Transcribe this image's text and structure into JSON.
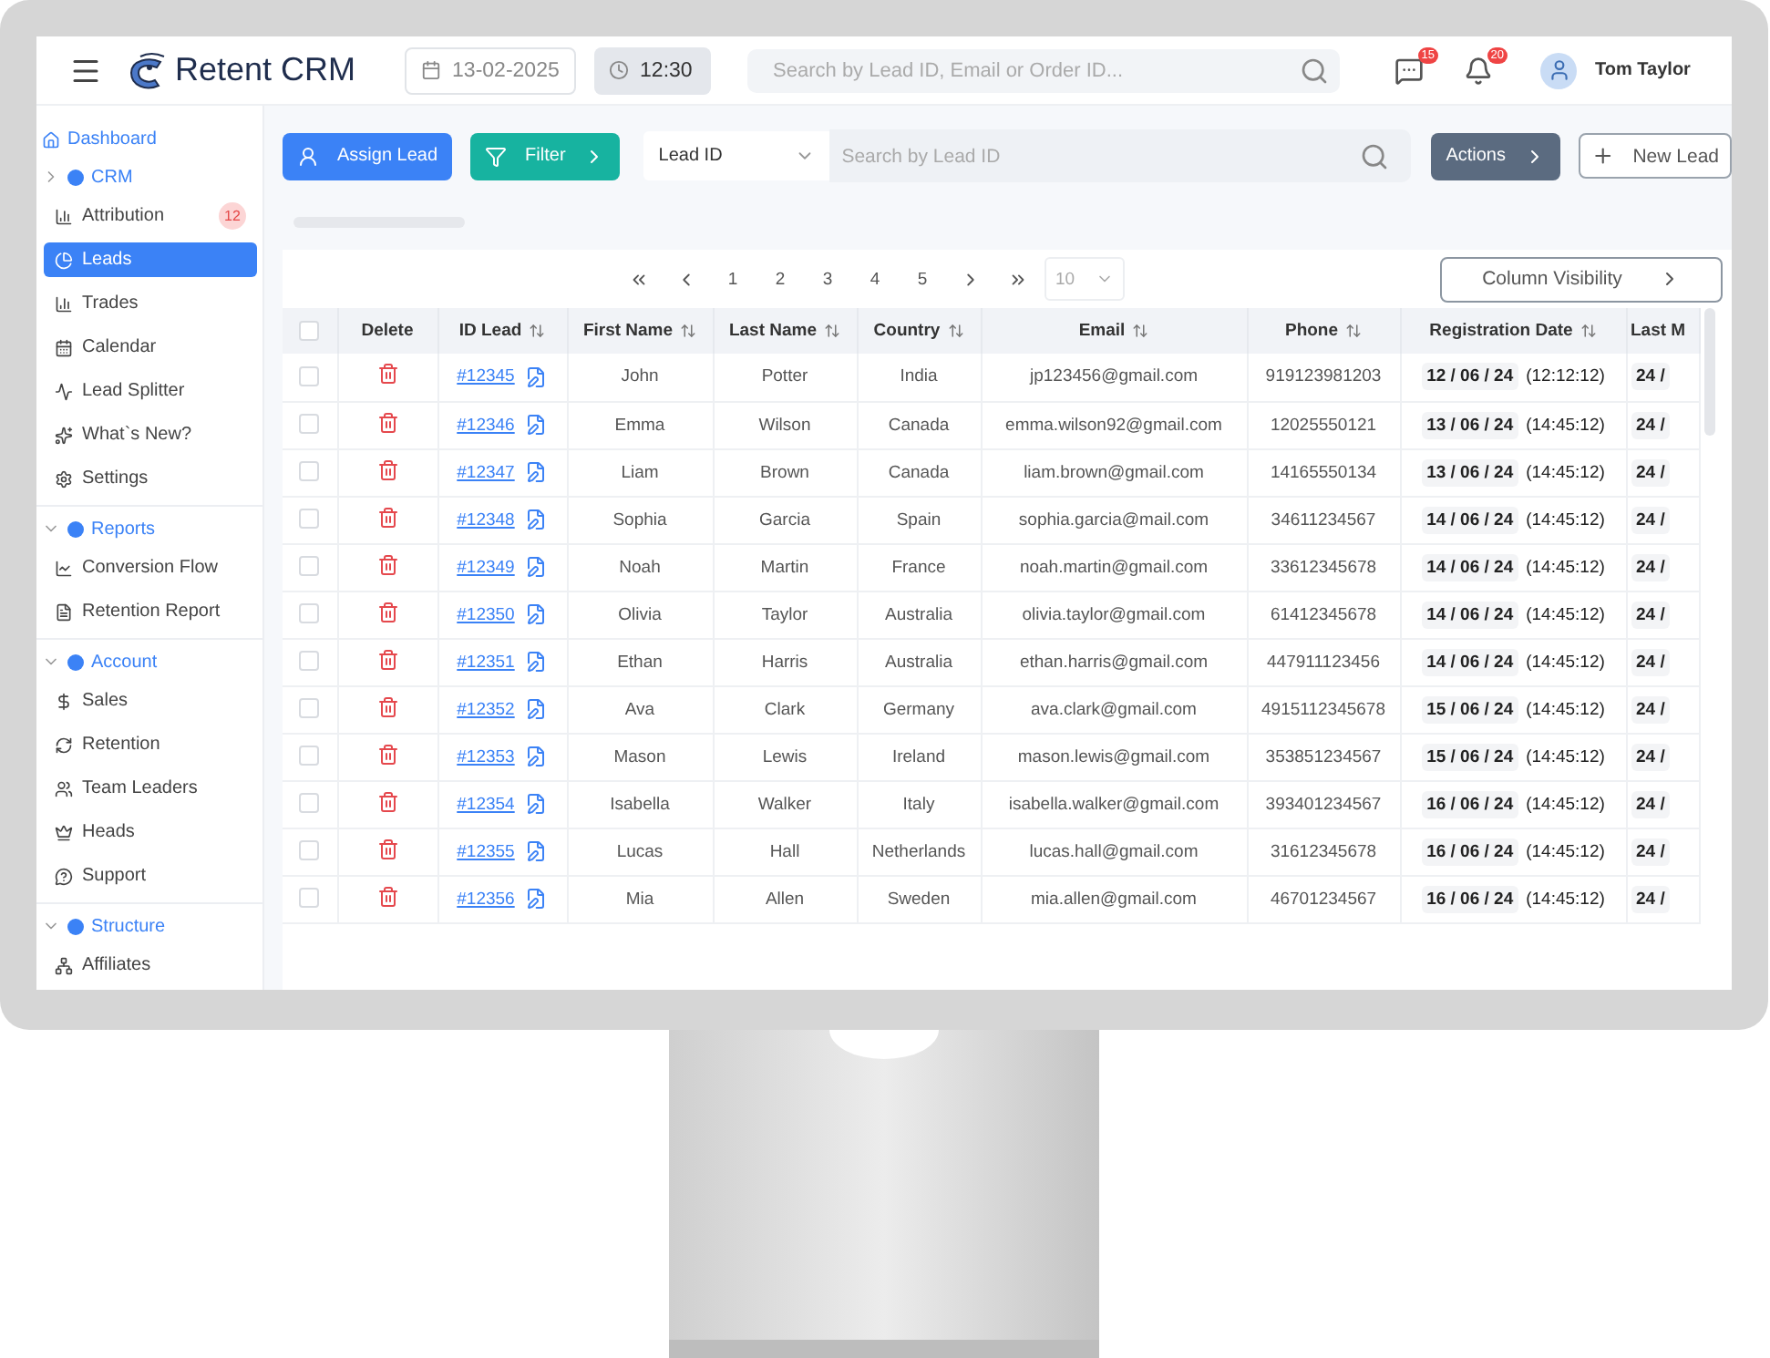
{
  "header": {
    "app_name": "Retent CRM",
    "date": "13-02-2025",
    "time": "12:30",
    "search": {
      "placeholder": "Search by Lead ID, Email or Order ID..."
    },
    "notifications": [
      {
        "count": "15"
      },
      {
        "count": "20"
      }
    ],
    "user": "Tom Taylor"
  },
  "sidebar": {
    "items": [
      {
        "kind": "link",
        "label": "Dashboard"
      },
      {
        "kind": "section",
        "label": "CRM",
        "expanded": false,
        "children": [
          {
            "label": "Attribution",
            "badge": "12",
            "selected": false
          },
          {
            "label": "Leads",
            "selected": true
          },
          {
            "label": "Trades",
            "selected": false
          },
          {
            "label": "Calendar",
            "selected": false
          },
          {
            "label": "Lead Splitter",
            "selected": false
          },
          {
            "label": "What`s New?",
            "selected": false
          },
          {
            "label": "Settings",
            "selected": false
          }
        ]
      },
      {
        "kind": "section",
        "label": "Reports",
        "expanded": true,
        "children": [
          {
            "label": "Conversion Flow",
            "selected": false
          },
          {
            "label": "Retention Report",
            "selected": false
          }
        ]
      },
      {
        "kind": "section",
        "label": "Account",
        "expanded": true,
        "children": [
          {
            "label": "Sales",
            "selected": false
          },
          {
            "label": "Retention",
            "selected": false
          },
          {
            "label": "Team Leaders",
            "selected": false
          },
          {
            "label": "Heads",
            "selected": false
          },
          {
            "label": "Support",
            "selected": false
          }
        ]
      },
      {
        "kind": "section",
        "label": "Structure",
        "expanded": true,
        "children": [
          {
            "label": "Affiliates",
            "selected": false
          }
        ]
      }
    ]
  },
  "toolbar": {
    "assign": "Assign Lead",
    "filter": "Filter",
    "field_select": "Lead ID",
    "search": {
      "placeholder": "Search by Lead ID"
    },
    "actions": "Actions",
    "new_lead": "New Lead"
  },
  "pagination": {
    "pages": [
      "1",
      "2",
      "3",
      "4",
      "5"
    ],
    "page_size": "10"
  },
  "column_visibility": "Column Visibility",
  "table": {
    "columns": [
      {
        "label": "Delete",
        "sortable": false
      },
      {
        "label": "ID Lead",
        "sortable": true
      },
      {
        "label": "First Name",
        "sortable": true
      },
      {
        "label": "Last Name",
        "sortable": true
      },
      {
        "label": "Country",
        "sortable": true
      },
      {
        "label": "Email",
        "sortable": true
      },
      {
        "label": "Phone",
        "sortable": true
      },
      {
        "label": "Registration Date",
        "sortable": true
      },
      {
        "label": "Last M",
        "sortable": false
      }
    ],
    "select_all": {
      "checked": false
    },
    "rows": [
      {
        "checked": false,
        "id": "#12345",
        "first": "John",
        "last": "Potter",
        "country": "India",
        "email": "jp123456@gmail.com",
        "phone": "919123981203",
        "date": "12 / 06 / 24",
        "time": "(12:12:12)",
        "column_9": "24 /"
      },
      {
        "checked": false,
        "id": "#12346",
        "first": "Emma",
        "last": "Wilson",
        "country": "Canada",
        "email": "emma.wilson92@gmail.com",
        "phone": "12025550121",
        "date": "13 / 06 / 24",
        "time": "(14:45:12)",
        "column_9": "24 /"
      },
      {
        "checked": false,
        "id": "#12347",
        "first": "Liam",
        "last": "Brown",
        "country": "Canada",
        "email": "liam.brown@gmail.com",
        "phone": "14165550134",
        "date": "13 / 06 / 24",
        "time": "(14:45:12)",
        "column_9": "24 /"
      },
      {
        "checked": false,
        "id": "#12348",
        "first": "Sophia",
        "last": "Garcia",
        "country": "Spain",
        "email": "sophia.garcia@mail.com",
        "phone": "34611234567",
        "date": "14 / 06 / 24",
        "time": "(14:45:12)",
        "column_9": "24 /"
      },
      {
        "checked": false,
        "id": "#12349",
        "first": "Noah",
        "last": "Martin",
        "country": "France",
        "email": "noah.martin@gmail.com",
        "phone": "33612345678",
        "date": "14 / 06 / 24",
        "time": "(14:45:12)",
        "column_9": "24 /"
      },
      {
        "checked": false,
        "id": "#12350",
        "first": "Olivia",
        "last": "Taylor",
        "country": "Australia",
        "email": "olivia.taylor@gmail.com",
        "phone": "61412345678",
        "date": "14 / 06 / 24",
        "time": "(14:45:12)",
        "column_9": "24 /"
      },
      {
        "checked": false,
        "id": "#12351",
        "first": "Ethan",
        "last": "Harris",
        "country": "Australia",
        "email": "ethan.harris@gmail.com",
        "phone": "447911123456",
        "date": "14 / 06 / 24",
        "time": "(14:45:12)",
        "column_9": "24 /"
      },
      {
        "checked": false,
        "id": "#12352",
        "first": "Ava",
        "last": "Clark",
        "country": "Germany",
        "email": "ava.clark@gmail.com",
        "phone": "4915112345678",
        "date": "15 / 06 / 24",
        "time": "(14:45:12)",
        "column_9": "24 /"
      },
      {
        "checked": false,
        "id": "#12353",
        "first": "Mason",
        "last": "Lewis",
        "country": "Ireland",
        "email": "mason.lewis@gmail.com",
        "phone": "353851234567",
        "date": "15 / 06 / 24",
        "time": "(14:45:12)",
        "column_9": "24 /"
      },
      {
        "checked": false,
        "id": "#12354",
        "first": "Isabella",
        "last": "Walker",
        "country": "Italy",
        "email": "isabella.walker@gmail.com",
        "phone": "393401234567",
        "date": "16 / 06 / 24",
        "time": "(14:45:12)",
        "column_9": "24 /"
      },
      {
        "checked": false,
        "id": "#12355",
        "first": "Lucas",
        "last": "Hall",
        "country": "Netherlands",
        "email": "lucas.hall@gmail.com",
        "phone": "31612345678",
        "date": "16 / 06 / 24",
        "time": "(14:45:12)",
        "column_9": "24 /"
      },
      {
        "checked": false,
        "id": "#12356",
        "first": "Mia",
        "last": "Allen",
        "country": "Sweden",
        "email": "mia.allen@gmail.com",
        "phone": "46701234567",
        "date": "16 / 06 / 24",
        "time": "(14:45:12)",
        "column_9": "24 /"
      }
    ]
  }
}
